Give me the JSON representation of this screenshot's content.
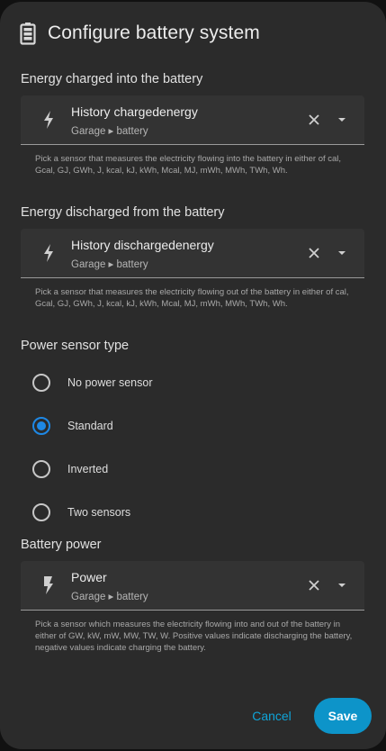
{
  "dialog": {
    "title": "Configure battery system",
    "icon": "battery-icon"
  },
  "charged": {
    "label": "Energy charged into the battery",
    "sensor_name": "History chargedenergy",
    "sensor_area": "Garage ▸ battery",
    "helper": "Pick a sensor that measures the electricity flowing into the battery in either of cal, Gcal, GJ, GWh, J, kcal, kJ, kWh, Mcal, MJ, mWh, MWh, TWh, Wh."
  },
  "discharged": {
    "label": "Energy discharged from the battery",
    "sensor_name": "History dischargedenergy",
    "sensor_area": "Garage ▸ battery",
    "helper": "Pick a sensor that measures the electricity flowing out of the battery in either of cal, Gcal, GJ, GWh, J, kcal, kJ, kWh, Mcal, MJ, mWh, MWh, TWh, Wh."
  },
  "power_type": {
    "label": "Power sensor type",
    "options": [
      {
        "label": "No power sensor",
        "checked": false
      },
      {
        "label": "Standard",
        "checked": true
      },
      {
        "label": "Inverted",
        "checked": false
      },
      {
        "label": "Two sensors",
        "checked": false
      }
    ]
  },
  "battery_power": {
    "label": "Battery power",
    "sensor_name": "Power",
    "sensor_area": "Garage ▸ battery",
    "helper": "Pick a sensor which measures the electricity flowing into and out of the battery in either of GW, kW, mW, MW, TW, W. Positive values indicate discharging the battery, negative values indicate charging the battery."
  },
  "actions": {
    "cancel": "Cancel",
    "save": "Save"
  },
  "colors": {
    "accent": "#1e88e5",
    "button": "#0d94c9",
    "link": "#0fa4d8",
    "surface": "#2b2b2b"
  }
}
